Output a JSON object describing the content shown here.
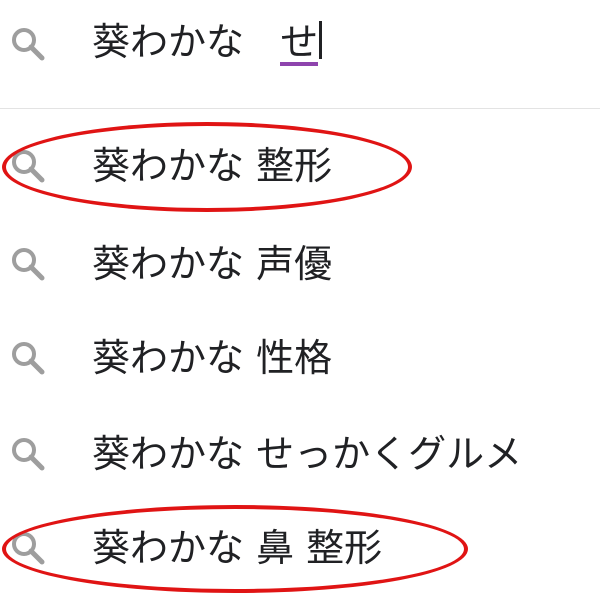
{
  "search": {
    "query_committed": "葵わかな",
    "query_composing": "せ",
    "icon": "search-icon"
  },
  "suggestions": [
    {
      "label": "葵わかな 整形",
      "icon": "search-icon",
      "highlighted": true
    },
    {
      "label": "葵わかな 声優",
      "icon": "search-icon",
      "highlighted": false
    },
    {
      "label": "葵わかな 性格",
      "icon": "search-icon",
      "highlighted": false
    },
    {
      "label": "葵わかな せっかくグルメ",
      "icon": "search-icon",
      "highlighted": false
    },
    {
      "label": "葵わかな 鼻 整形",
      "icon": "search-icon",
      "highlighted": true
    }
  ],
  "colors": {
    "text": "#202124",
    "icon": "#9e9e9e",
    "highlight": "#e01414",
    "composing_underline": "#8e44ad",
    "divider": "#e3e3e3"
  }
}
